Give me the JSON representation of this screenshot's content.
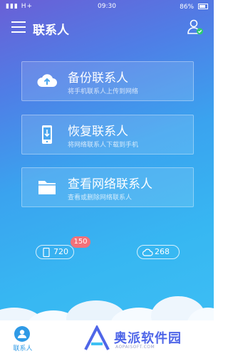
{
  "statusbar": {
    "network": "H+",
    "time": "09:30",
    "battery": "86%"
  },
  "header": {
    "title": "联系人"
  },
  "cards": [
    {
      "title": "备份联系人",
      "subtitle": "将手机联系人上传到网络"
    },
    {
      "title": "恢复联系人",
      "subtitle": "将网络联系人下载到手机"
    },
    {
      "title": "查看网络联系人",
      "subtitle": "查看或删除网络联系人"
    }
  ],
  "counts": {
    "phone": "720",
    "phone_badge": "150",
    "cloud": "268"
  },
  "bottom": {
    "tab_label": "联系人"
  },
  "watermark": {
    "name": "奥派软件园",
    "url": "AOPAISOFT.COM"
  },
  "colors": {
    "accent": "#2f9ae6",
    "badge": "#f2717a",
    "watermark": "#4f66e8"
  }
}
